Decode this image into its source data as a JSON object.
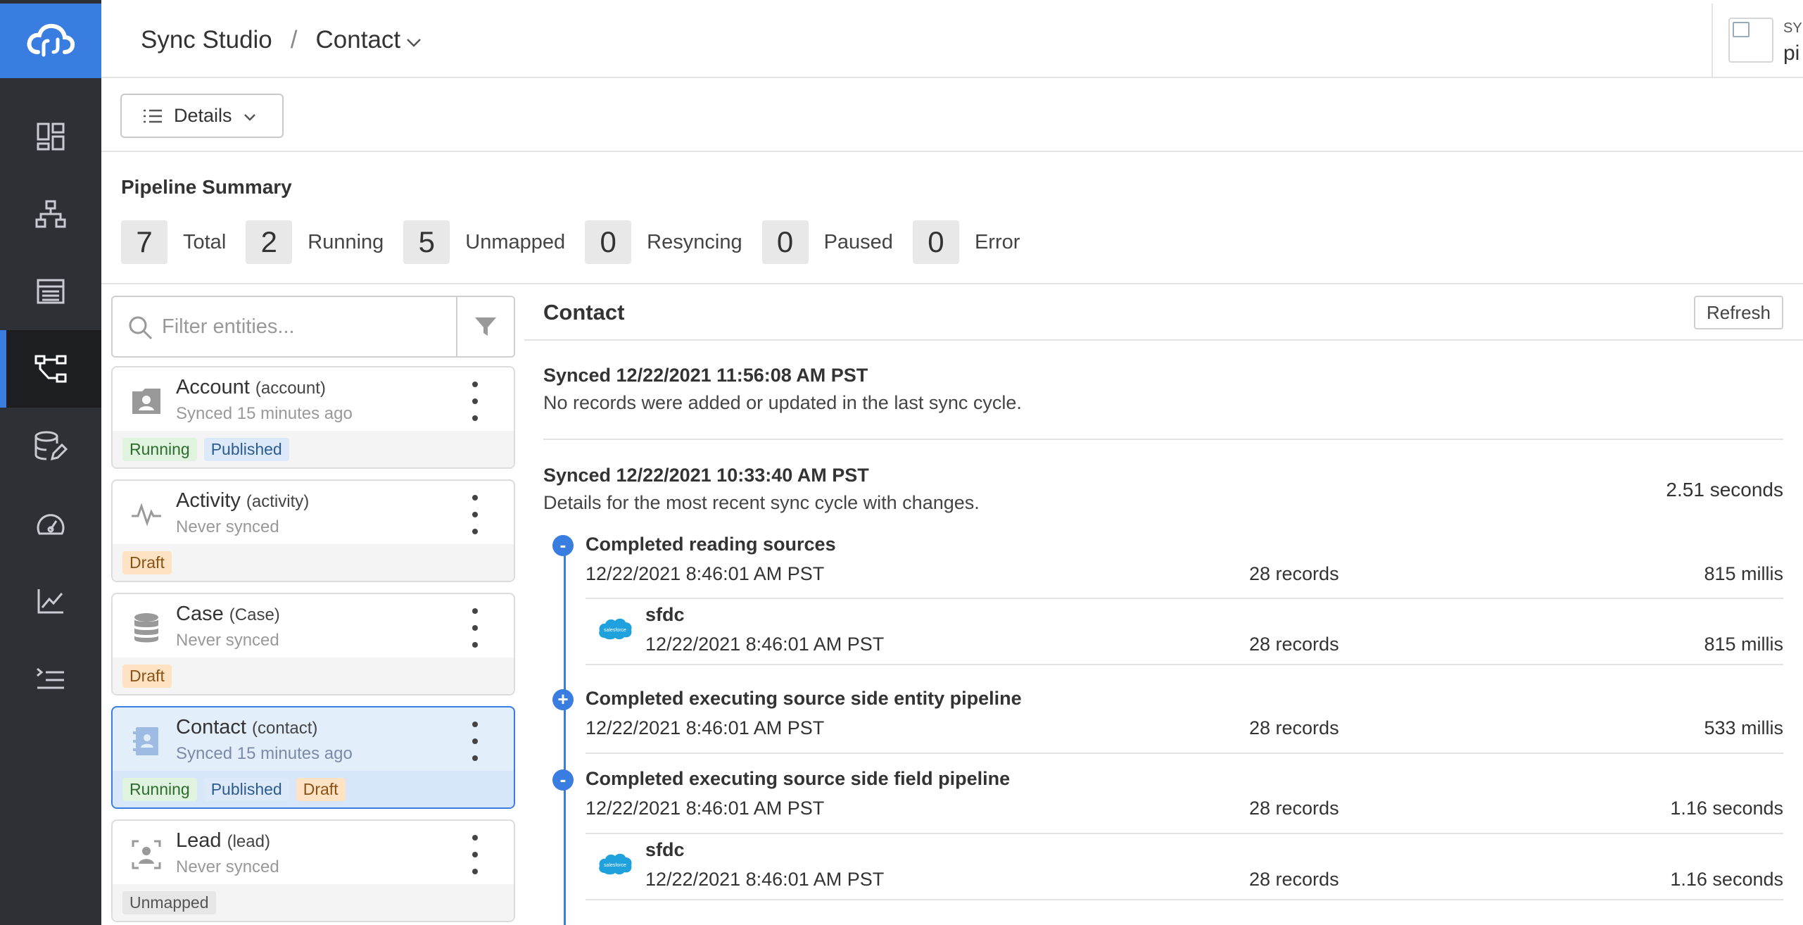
{
  "header": {
    "app_name": "Sync Studio",
    "separator": "/",
    "current_entity": "Contact",
    "user_label": "SY",
    "user_name": "pi"
  },
  "sidebar": {
    "items": [
      {
        "name": "dashboard-icon"
      },
      {
        "name": "hierarchy-icon"
      },
      {
        "name": "table-icon"
      },
      {
        "name": "pipeline-icon",
        "active": true
      },
      {
        "name": "database-edit-icon"
      },
      {
        "name": "gauge-icon"
      },
      {
        "name": "line-chart-icon"
      },
      {
        "name": "log-list-icon"
      }
    ]
  },
  "toolbar": {
    "details_label": "Details"
  },
  "summary": {
    "title": "Pipeline Summary",
    "stats": [
      {
        "value": "7",
        "label": "Total"
      },
      {
        "value": "2",
        "label": "Running"
      },
      {
        "value": "5",
        "label": "Unmapped"
      },
      {
        "value": "0",
        "label": "Resyncing"
      },
      {
        "value": "0",
        "label": "Paused"
      },
      {
        "value": "0",
        "label": "Error"
      }
    ]
  },
  "filter": {
    "placeholder": "Filter entities..."
  },
  "entities": [
    {
      "name": "Account",
      "api": "(account)",
      "status": "Synced 15 minutes ago",
      "icon": "contact-card-icon",
      "badges": [
        "Running",
        "Published"
      ]
    },
    {
      "name": "Activity",
      "api": "(activity)",
      "status": "Never synced",
      "icon": "activity-icon",
      "badges": [
        "Draft"
      ]
    },
    {
      "name": "Case",
      "api": "(Case)",
      "status": "Never synced",
      "icon": "database-icon",
      "badges": [
        "Draft"
      ]
    },
    {
      "name": "Contact",
      "api": "(contact)",
      "status": "Synced 15 minutes ago",
      "icon": "address-book-icon",
      "badges": [
        "Running",
        "Published",
        "Draft"
      ],
      "selected": true
    },
    {
      "name": "Lead",
      "api": "(lead)",
      "status": "Never synced",
      "icon": "lead-user-icon",
      "badges": [
        "Unmapped"
      ]
    }
  ],
  "detail": {
    "title": "Contact",
    "refresh_label": "Refresh",
    "latest": {
      "title": "Synced 12/22/2021 11:56:08 AM PST",
      "desc": "No records were added or updated in the last sync cycle."
    },
    "recent": {
      "title": "Synced 12/22/2021 10:33:40 AM PST",
      "desc": "Details for the most recent sync cycle with changes.",
      "duration": "2.51 seconds"
    },
    "steps": [
      {
        "marker": "-",
        "title": "Completed reading sources",
        "time": "12/22/2021 8:46:01 AM PST",
        "records": "28 records",
        "duration": "815 millis",
        "source": {
          "name": "sfdc",
          "time": "12/22/2021 8:46:01 AM PST",
          "records": "28 records",
          "duration": "815 millis"
        }
      },
      {
        "marker": "+",
        "title": "Completed executing source side entity pipeline",
        "time": "12/22/2021 8:46:01 AM PST",
        "records": "28 records",
        "duration": "533 millis"
      },
      {
        "marker": "-",
        "title": "Completed executing source side field pipeline",
        "time": "12/22/2021 8:46:01 AM PST",
        "records": "28 records",
        "duration": "1.16 seconds",
        "source": {
          "name": "sfdc",
          "time": "12/22/2021 8:46:01 AM PST",
          "records": "28 records",
          "duration": "1.16 seconds"
        }
      }
    ],
    "logo_text": "salesforce"
  },
  "colors": {
    "accent": "#3a7de0",
    "sidebar": "#2d3035",
    "running": "#dff3df",
    "published": "#dce9f8",
    "draft": "#fde2c4",
    "unmapped": "#e6e6e6"
  }
}
